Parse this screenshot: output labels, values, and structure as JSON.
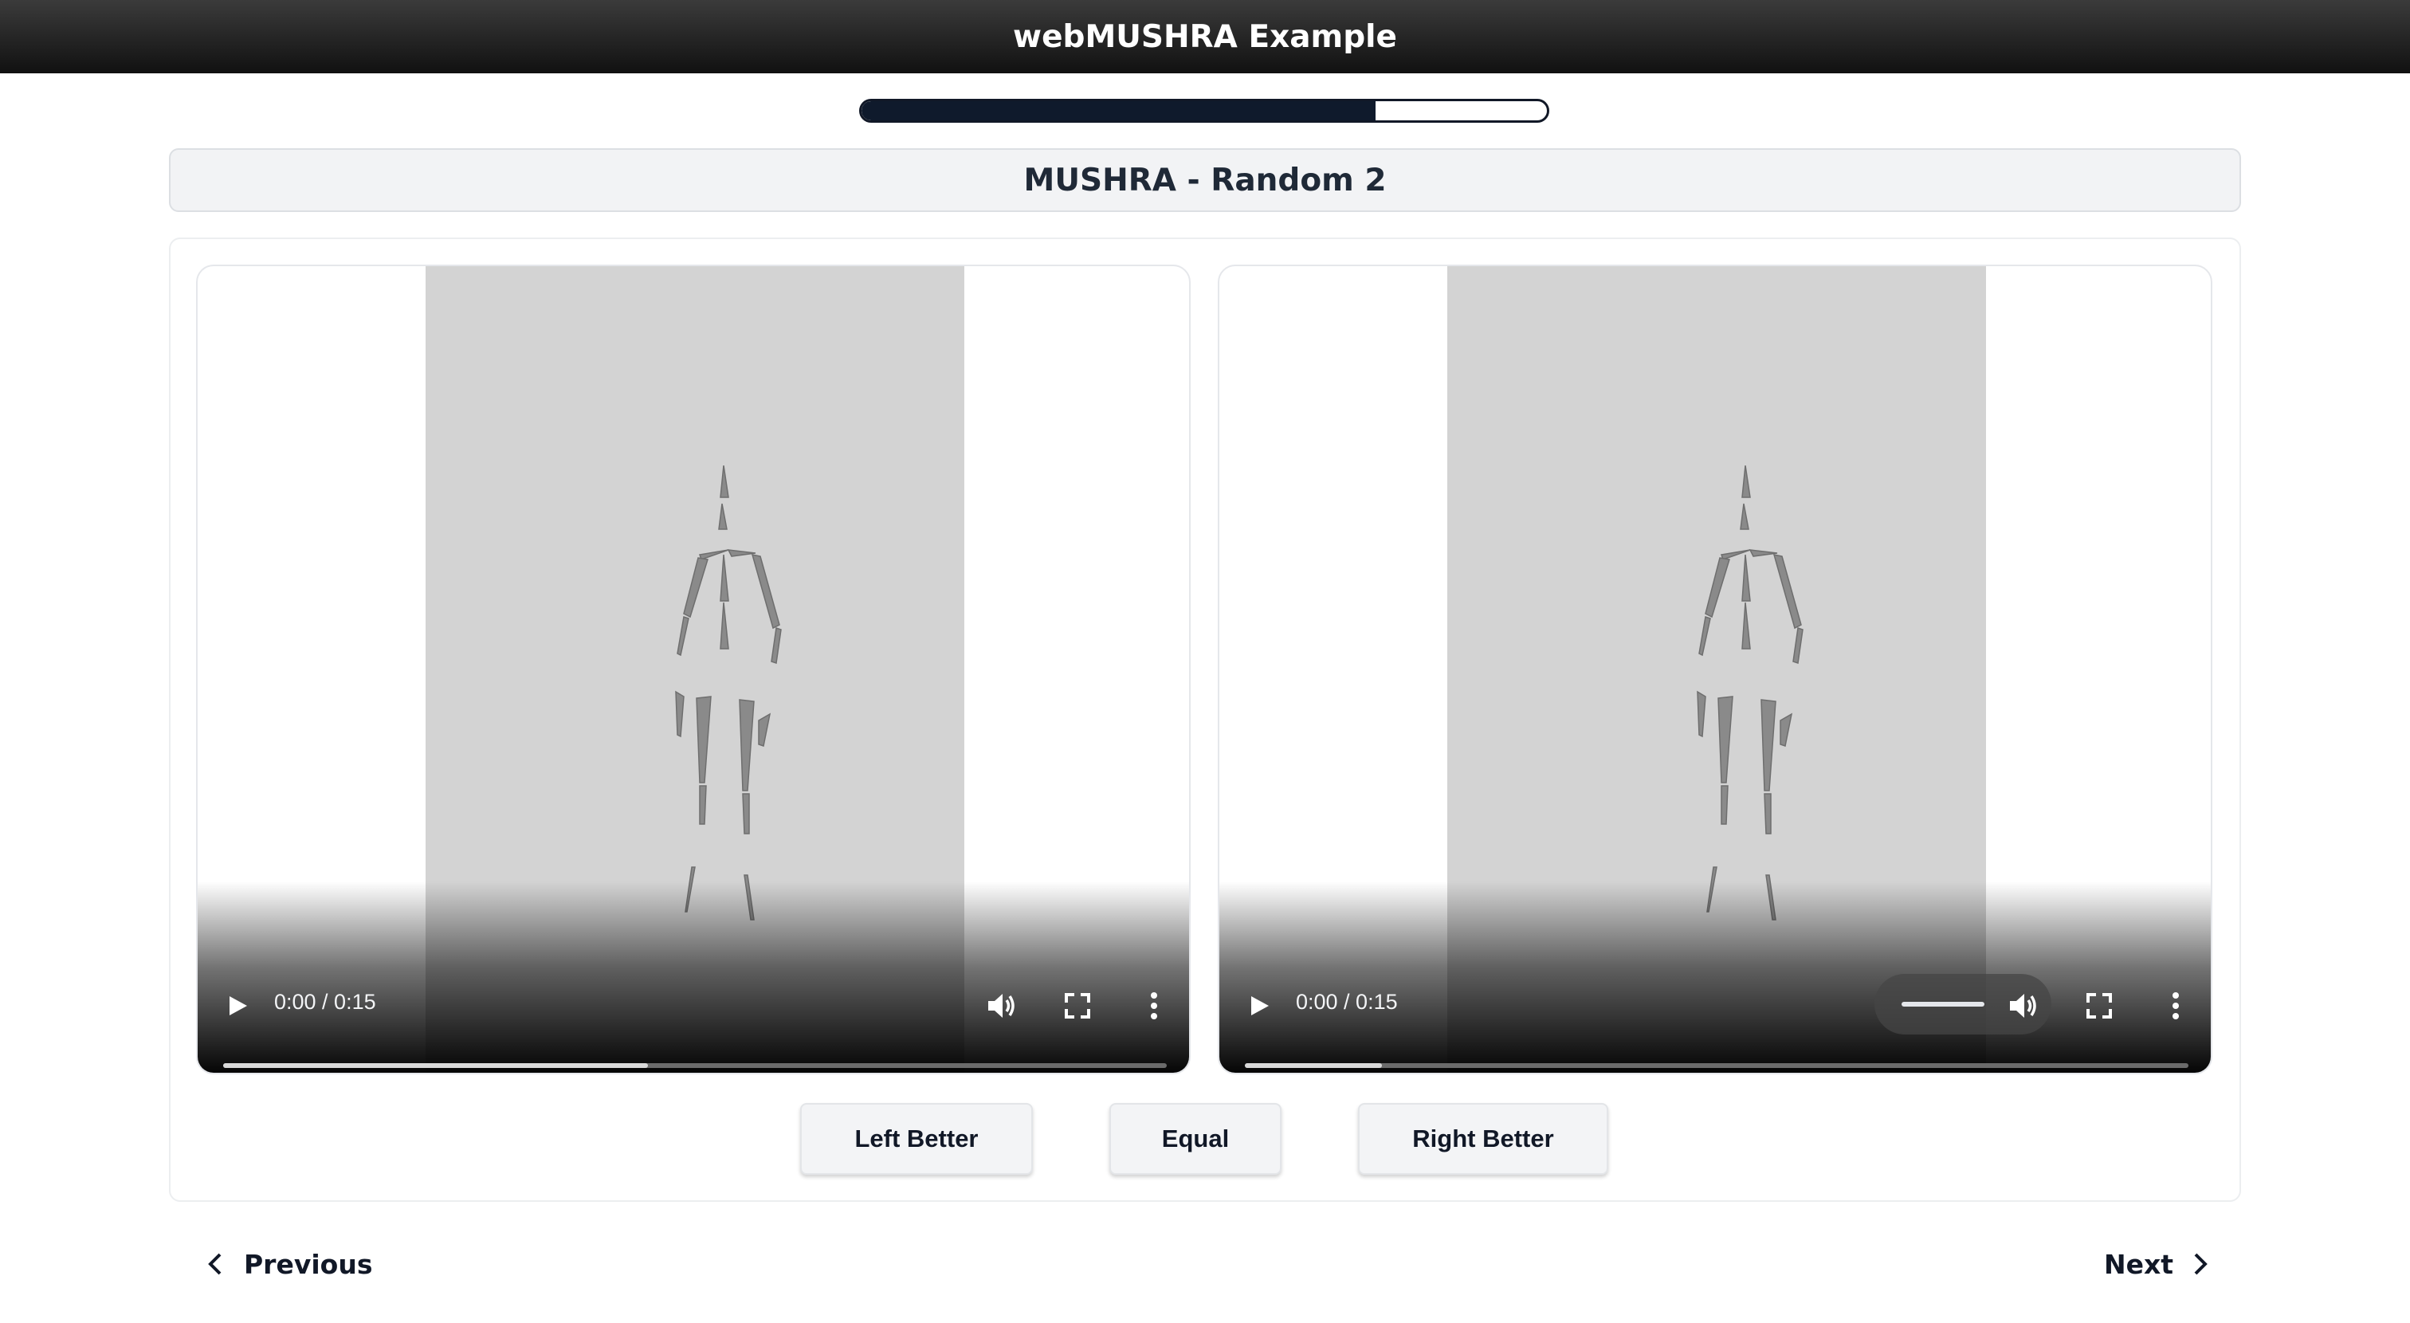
{
  "app": {
    "title": "webMUSHRA Example"
  },
  "progress": {
    "fraction": 0.75
  },
  "page": {
    "heading": "MUSHRA - Random 2"
  },
  "videos": [
    {
      "id": "left",
      "time": "0:00 / 0:15",
      "seek_fraction": 0.45,
      "icons": [
        "play-icon",
        "volume-icon",
        "fullscreen-icon",
        "more-options-icon"
      ]
    },
    {
      "id": "right",
      "time": "0:00 / 0:15",
      "seek_fraction": 0.145,
      "volume_slider_visible": true,
      "icons": [
        "play-icon",
        "volume-icon",
        "fullscreen-icon",
        "more-options-icon"
      ]
    }
  ],
  "choices": {
    "left": "Left Better",
    "equal": "Equal",
    "right": "Right Better"
  },
  "nav": {
    "previous": "Previous",
    "next": "Next"
  },
  "colors": {
    "topbar": "#1f1f1f",
    "progress_fill": "#0f1a2c",
    "video_frame": "#d3d3d3"
  }
}
